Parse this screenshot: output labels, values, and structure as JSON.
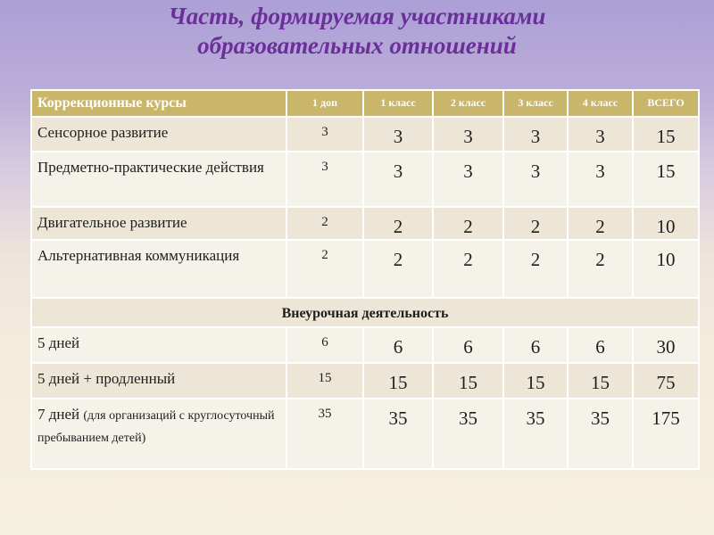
{
  "title": {
    "line1": "Часть, формируемая участниками",
    "line2": "образовательных отношений"
  },
  "table": {
    "headers": [
      "Коррекционные курсы",
      "1 доп",
      "1 класс",
      "2 класс",
      "3 класс",
      "4 класс",
      "ВСЕГО"
    ],
    "rows": [
      {
        "name": "Сенсорное  развитие",
        "values": [
          "3",
          "3",
          "3",
          "3",
          "3",
          "15"
        ]
      },
      {
        "name": "Предметно-практические действия",
        "values": [
          "3",
          "3",
          "3",
          "3",
          "3",
          "15"
        ]
      },
      {
        "name": "Двигательное  развитие",
        "values": [
          "2",
          "2",
          "2",
          "2",
          "2",
          "10"
        ]
      },
      {
        "name": "Альтернативная коммуникация",
        "values": [
          "2",
          "2",
          "2",
          "2",
          "2",
          "10"
        ]
      }
    ],
    "section_title": "Внеурочная деятельность",
    "section_rows": [
      {
        "name": "5 дней",
        "values": [
          "6",
          "6",
          "6",
          "6",
          "6",
          "30"
        ]
      },
      {
        "name": "5 дней + продленный",
        "values": [
          "15",
          "15",
          "15",
          "15",
          "15",
          "75"
        ]
      },
      {
        "name": "7 дней",
        "note": "(для организаций с круглосуточный пребыванием детей)",
        "values": [
          "35",
          "35",
          "35",
          "35",
          "35",
          "175"
        ]
      }
    ]
  },
  "colors": {
    "title": "#6b2f9a",
    "header_bg": "#c9b66b",
    "row_odd": "#ede6d6",
    "row_even": "#f5f2ea"
  }
}
